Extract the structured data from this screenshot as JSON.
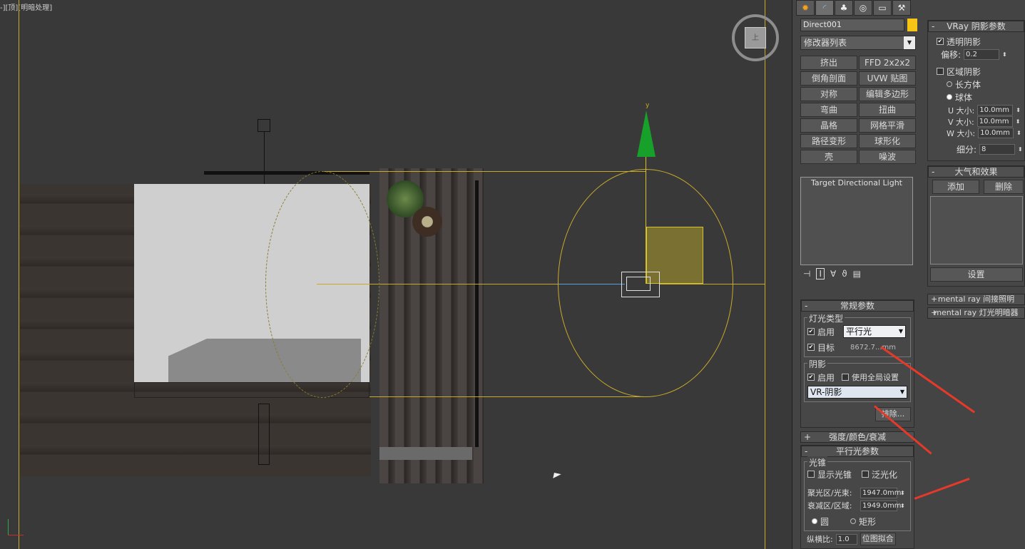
{
  "viewport": {
    "label": "-][顶][明暗处理]",
    "y_axis_label": "y",
    "viewcube_label": "上"
  },
  "command_panel": {
    "tabs": [
      "create",
      "modify",
      "hierarchy",
      "motion",
      "display",
      "utilities"
    ],
    "object_name": "Direct001",
    "object_color": "#f6c414",
    "modifier_list_label": "修改器列表",
    "modifiers": [
      "挤出",
      "FFD 2x2x2",
      "倒角剖面",
      "UVW 贴图",
      "对称",
      "编辑多边形",
      "弯曲",
      "扭曲",
      "晶格",
      "网格平滑",
      "路径变形",
      "球形化",
      "壳",
      "噪波"
    ],
    "stack_item": "Target Directional Light"
  },
  "general_params": {
    "title": "常规参数",
    "light_type_group": "灯光类型",
    "enable_label": "启用",
    "light_type_value": "平行光",
    "target_label": "目标",
    "target_distance": "8672.7...mm",
    "shadow_group": "阴影",
    "shadow_enable_label": "启用",
    "global_settings_label": "使用全局设置",
    "shadow_type_value": "VR-阴影",
    "exclude_label": "排除..."
  },
  "collapsed_rollouts": {
    "intensity": "强度/颜色/衰减",
    "mr_indirect": "mental ray 间接照明",
    "mr_shader": "mental ray 灯光明暗器"
  },
  "directional_params": {
    "title": "平行光参数",
    "cone_group": "光锥",
    "show_cone_label": "显示光锥",
    "overshoot_label": "泛光化",
    "hotspot_label": "聚光区/光束:",
    "hotspot_value": "1947.0mm",
    "falloff_label": "衰减区/区域:",
    "falloff_value": "1949.0mm",
    "circle_label": "圆",
    "rect_label": "矩形",
    "aspect_label": "纵横比:",
    "aspect_value": "1.0",
    "bitmap_fit_label": "位图拟合"
  },
  "vray_shadow": {
    "title": "VRay 阴影参数",
    "transparent_label": "透明阴影",
    "bias_label": "偏移:",
    "bias_value": "0.2",
    "area_label": "区域阴影",
    "box_label": "长方体",
    "sphere_label": "球体",
    "u_label": "U 大小:",
    "u_value": "10.0mm",
    "v_label": "V 大小:",
    "v_value": "10.0mm",
    "w_label": "W 大小:",
    "w_value": "10.0mm",
    "subdiv_label": "细分:",
    "subdiv_value": "8"
  },
  "atmos": {
    "title": "大气和效果",
    "add_label": "添加",
    "delete_label": "删除",
    "setup_label": "设置"
  },
  "colors": {
    "accent_yellow": "#c9a92a",
    "gizmo_green": "#17a12a",
    "annotation_red": "#e53a2a"
  }
}
